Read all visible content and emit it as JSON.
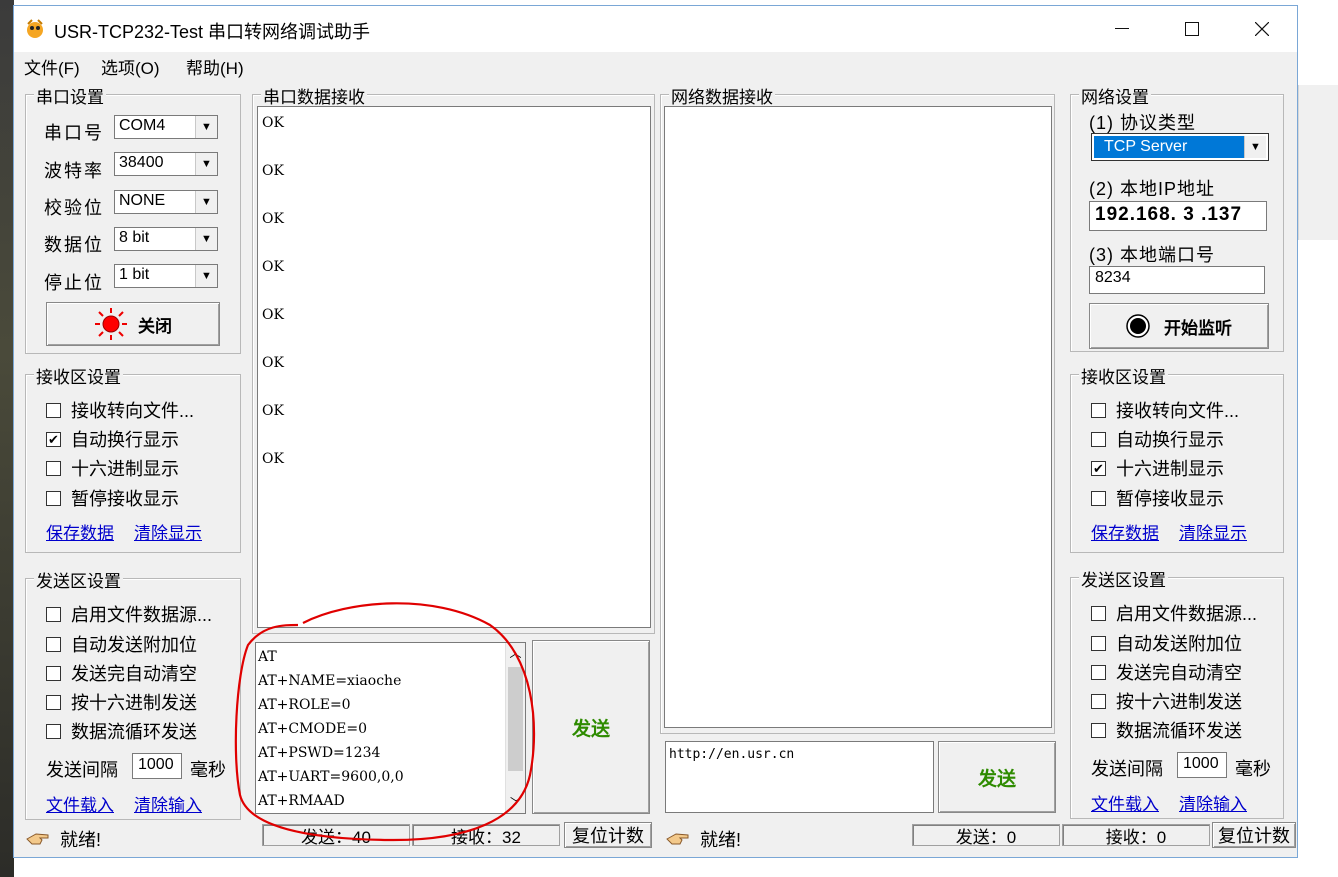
{
  "window": {
    "title": "USR-TCP232-Test 串口转网络调试助手",
    "menu": [
      "文件(F)",
      "选项(O)",
      "帮助(H)"
    ]
  },
  "serial_settings": {
    "title": "串口设置",
    "port_label": "串口号",
    "port_value": "COM4",
    "baud_label": "波特率",
    "baud_value": "38400",
    "parity_label": "校验位",
    "parity_value": "NONE",
    "databits_label": "数据位",
    "databits_value": "8 bit",
    "stopbits_label": "停止位",
    "stopbits_value": "1 bit",
    "open_close_label": "关闭"
  },
  "left_recv_settings": {
    "title": "接收区设置",
    "options": [
      "接收转向文件...",
      "自动换行显示",
      "十六进制显示",
      "暂停接收显示"
    ],
    "checked": [
      false,
      true,
      false,
      false
    ],
    "save_label": "保存数据",
    "clear_label": "清除显示"
  },
  "left_send_settings": {
    "title": "发送区设置",
    "options": [
      "启用文件数据源...",
      "自动发送附加位",
      "发送完自动清空",
      "按十六进制发送",
      "数据流循环发送"
    ],
    "checked": [
      false,
      false,
      false,
      false,
      false
    ],
    "interval_label": "发送间隔",
    "interval_value": "1000",
    "interval_unit": "毫秒",
    "load_file_label": "文件载入",
    "clear_input_label": "清除输入"
  },
  "serial_receive": {
    "title": "串口数据接收",
    "lines": [
      "OK",
      "OK",
      "OK",
      "OK",
      "OK",
      "OK",
      "OK",
      "OK"
    ]
  },
  "serial_send": {
    "lines": [
      "AT",
      "AT+NAME=xiaoche",
      "AT+ROLE=0",
      "AT+CMODE=0",
      "AT+PSWD=1234",
      "AT+UART=9600,0,0",
      "AT+RMAAD"
    ],
    "send_label": "发送"
  },
  "network_receive": {
    "title": "网络数据接收"
  },
  "network_send": {
    "text": "http://en.usr.cn",
    "send_label": "发送"
  },
  "network_settings": {
    "title": "网络设置",
    "protocol_label": "(1) 协议类型",
    "protocol_value": "TCP Server",
    "ip_label": "(2) 本地IP地址",
    "ip_value": "192.168. 3 .137",
    "port_label": "(3) 本地端口号",
    "port_value": "8234",
    "listen_label": "开始监听"
  },
  "right_recv_settings": {
    "title": "接收区设置",
    "options": [
      "接收转向文件...",
      "自动换行显示",
      "十六进制显示",
      "暂停接收显示"
    ],
    "checked": [
      false,
      false,
      true,
      false
    ],
    "save_label": "保存数据",
    "clear_label": "清除显示"
  },
  "right_send_settings": {
    "title": "发送区设置",
    "options": [
      "启用文件数据源...",
      "自动发送附加位",
      "发送完自动清空",
      "按十六进制发送",
      "数据流循环发送"
    ],
    "checked": [
      false,
      false,
      false,
      false,
      false
    ],
    "interval_label": "发送间隔",
    "interval_value": "1000",
    "interval_unit": "毫秒",
    "load_file_label": "文件载入",
    "clear_input_label": "清除输入"
  },
  "status_left": {
    "ready": "就绪!",
    "sent": "发送：40",
    "received": "接收：32",
    "reset": "复位计数"
  },
  "status_right": {
    "ready": "就绪!",
    "sent": "发送：0",
    "received": "接收：0",
    "reset": "复位计数"
  },
  "colors": {
    "window_bg": "#f0f0f0",
    "link": "#0000cc",
    "send_button_text": "#2e8b00",
    "selection": "#0078d7",
    "annotation": "#e00000"
  }
}
